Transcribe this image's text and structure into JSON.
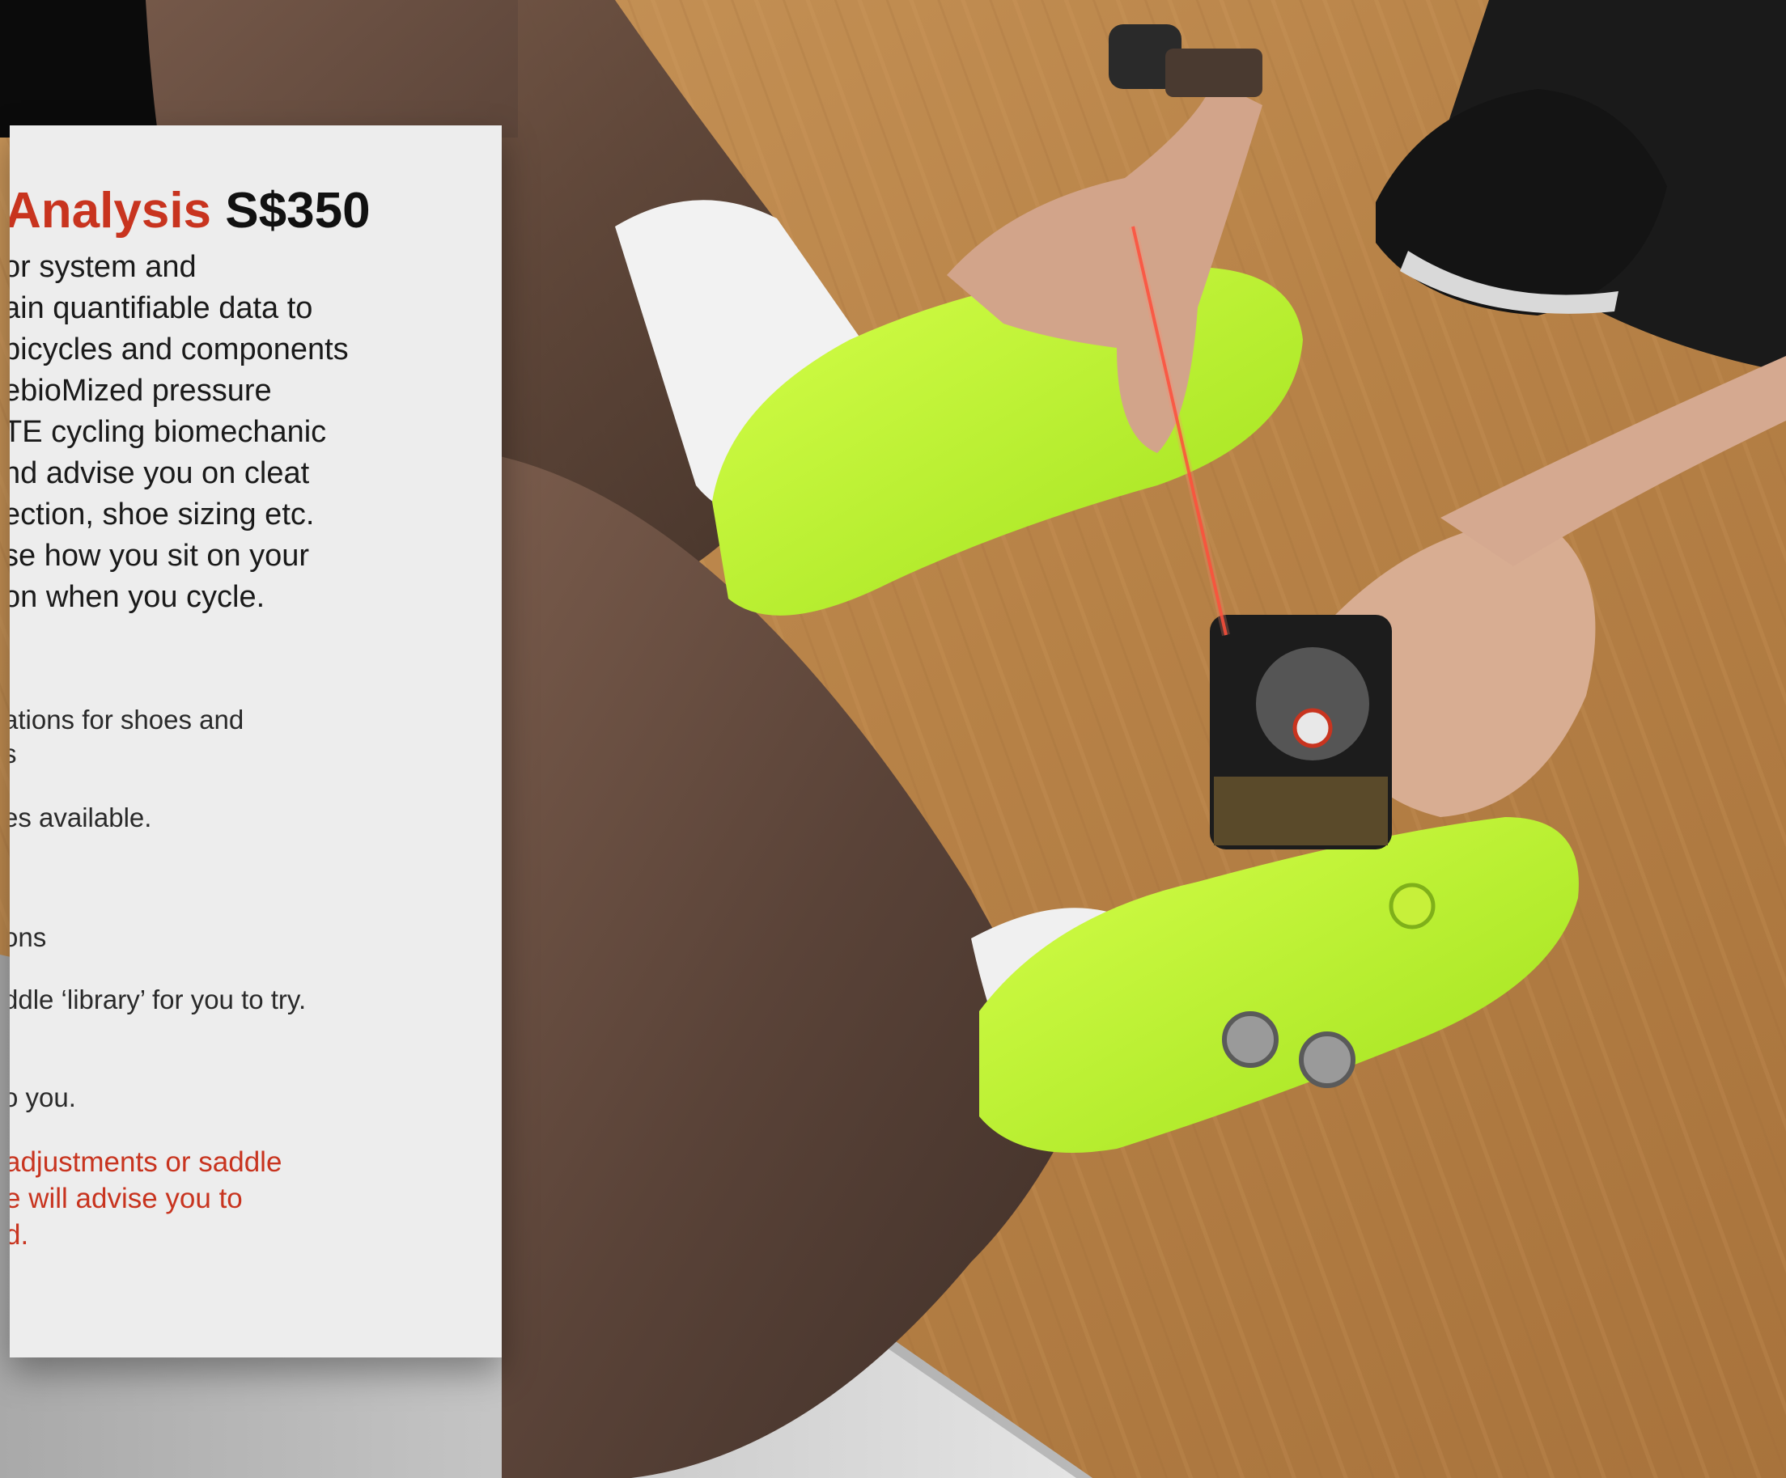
{
  "card": {
    "title_red": "Analysis",
    "title_price": "S$350",
    "description_lines": [
      "or system and",
      "ain quantifiable data to",
      " bicycles and components",
      "ebioMized pressure",
      "TE cycling biomechanic",
      "nd advise you on cleat",
      "ection, shoe sizing etc.",
      "se how you sit on your",
      "on when you cycle."
    ],
    "items": [
      "ations for shoes and",
      "s",
      "es available.",
      "ons",
      "ddle ‘library’ for you to try.",
      "o you."
    ],
    "note_lines": [
      "adjustments or saddle",
      "e will advise you to",
      "d."
    ]
  },
  "colors": {
    "accent": "#c8341f",
    "card_bg": "#ededed",
    "shoe": "#b4f02c",
    "floor": "#b88548"
  }
}
